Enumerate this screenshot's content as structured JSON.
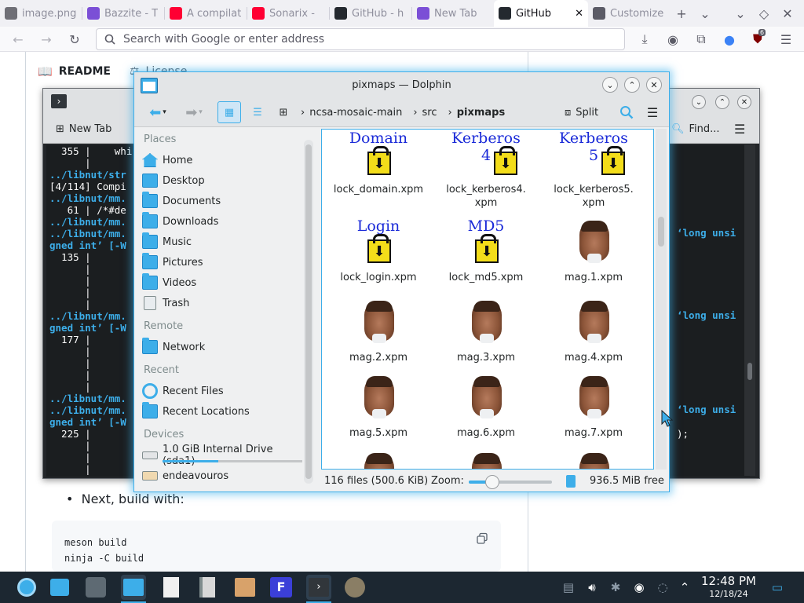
{
  "browser": {
    "tabs": [
      {
        "label": "image.png",
        "favicon_color": "#6f6f76"
      },
      {
        "label": "Bazzite - T",
        "favicon_color": "#7b4fd6"
      },
      {
        "label": "A compilat",
        "favicon_color": "#ff0033"
      },
      {
        "label": "Sonarix - ",
        "favicon_color": "#ff0033"
      },
      {
        "label": "GitHub - h",
        "favicon_color": "#24292f"
      },
      {
        "label": "New Tab",
        "favicon_color": "#7b4fd6"
      },
      {
        "label": "GitHub",
        "favicon_color": "#24292f",
        "active": true
      },
      {
        "label": "Customize",
        "favicon_color": "#5b5b66"
      }
    ],
    "address_placeholder": "Search with Google or enter address",
    "extension_badge": "6"
  },
  "github": {
    "readme_tab": "README",
    "license_tab": "License",
    "next_step": "Next, build with:",
    "code_lines": [
      "meson build",
      "ninja -C build"
    ]
  },
  "konsole": {
    "new_tab": "New Tab",
    "find": "Find...",
    "lines": [
      {
        "t": "  355 |    whi",
        "k": "plain"
      },
      {
        "t": "      |",
        "k": "plain"
      },
      {
        "t": "../libnut/str",
        "k": "path"
      },
      {
        "t": "[4/114] Compi",
        "k": "plain"
      },
      {
        "t": "../libnut/mm.",
        "k": "path"
      },
      {
        "t": "   61 | /*#de",
        "k": "plain"
      },
      {
        "t": "../libnut/mm.",
        "k": "path"
      },
      {
        "t": "../libnut/mm.",
        "k": "path"
      },
      {
        "t": "gned int’ [-W",
        "k": "gned"
      },
      {
        "t": "  135 |",
        "k": "plain"
      },
      {
        "t": "      |",
        "k": "plain"
      },
      {
        "t": "      |",
        "k": "plain"
      },
      {
        "t": "      |",
        "k": "plain"
      },
      {
        "t": "      |",
        "k": "plain"
      },
      {
        "t": "../libnut/mm.",
        "k": "path"
      },
      {
        "t": "gned int’ [-W",
        "k": "gned"
      },
      {
        "t": "  177 |",
        "k": "plain"
      },
      {
        "t": "      |",
        "k": "plain"
      },
      {
        "t": "      |",
        "k": "plain"
      },
      {
        "t": "      |",
        "k": "plain"
      },
      {
        "t": "      |",
        "k": "plain"
      },
      {
        "t": "../libnut/mm.",
        "k": "path"
      },
      {
        "t": "../libnut/mm.",
        "k": "path"
      },
      {
        "t": "gned int’ [-W",
        "k": "gned"
      },
      {
        "t": "  225 |",
        "k": "plain"
      },
      {
        "t": "      |",
        "k": "plain"
      },
      {
        "t": "      |",
        "k": "plain"
      },
      {
        "t": "      |",
        "k": "plain"
      }
    ],
    "right_fragment": "‘long unsi",
    "right_tail": ");"
  },
  "dolphin": {
    "title": "pixmaps — Dolphin",
    "split": "Split",
    "breadcrumb": [
      "ncsa-mosaic-main",
      "src",
      "pixmaps"
    ],
    "places": {
      "places_header": "Places",
      "places": [
        "Home",
        "Desktop",
        "Documents",
        "Downloads",
        "Music",
        "Pictures",
        "Videos",
        "Trash"
      ],
      "remote_header": "Remote",
      "remote": [
        "Network"
      ],
      "recent_header": "Recent",
      "recent": [
        "Recent Files",
        "Recent Locations"
      ],
      "devices_header": "Devices",
      "devices": [
        "1.0 GiB Internal Drive (sda1)",
        "endeavouros"
      ]
    },
    "files": [
      {
        "name": "lock_domain.xpm",
        "thumb": "lock",
        "caption": "Domain"
      },
      {
        "name": "lock_kerberos4.\nxpm",
        "thumb": "lock",
        "caption": "Kerberos\n4"
      },
      {
        "name": "lock_kerberos5.\nxpm",
        "thumb": "lock",
        "caption": "Kerberos\n5"
      },
      {
        "name": "lock_login.xpm",
        "thumb": "lock",
        "caption": "Login"
      },
      {
        "name": "lock_md5.xpm",
        "thumb": "lock",
        "caption": "MD5"
      },
      {
        "name": "mag.1.xpm",
        "thumb": "head"
      },
      {
        "name": "mag.2.xpm",
        "thumb": "head"
      },
      {
        "name": "mag.3.xpm",
        "thumb": "head"
      },
      {
        "name": "mag.4.xpm",
        "thumb": "head"
      },
      {
        "name": "mag.5.xpm",
        "thumb": "head"
      },
      {
        "name": "mag.6.xpm",
        "thumb": "head"
      },
      {
        "name": "mag.7.xpm",
        "thumb": "head"
      }
    ],
    "status": {
      "summary": "116 files (500.6 KiB)",
      "zoom_label": "Zoom:",
      "zoom_level_fraction": 0.28,
      "free": "936.5 MiB free"
    }
  },
  "taskbar": {
    "time": "12:48 PM",
    "date": "12/18/24"
  }
}
